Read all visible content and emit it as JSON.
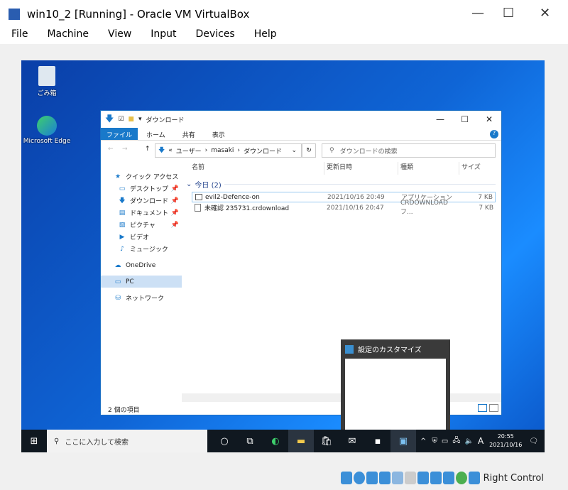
{
  "window": {
    "title": "win10_2 [Running] - Oracle VM VirtualBox",
    "minimize": "—",
    "maximize": "☐",
    "close": "✕"
  },
  "menu": [
    "File",
    "Machine",
    "View",
    "Input",
    "Devices",
    "Help"
  ],
  "desktop": {
    "icons": [
      {
        "label": "ごみ箱",
        "icon": "recycle-bin"
      },
      {
        "label": "Microsoft Edge",
        "icon": "edge"
      }
    ]
  },
  "explorer": {
    "title": "ダウンロード",
    "ribbon_tabs": [
      "ファイル",
      "ホーム",
      "共有",
      "表示"
    ],
    "address": {
      "prefix": "«",
      "parts": [
        "ユーザー",
        "masaki",
        "ダウンロード"
      ]
    },
    "search_placeholder": "ダウンロードの検索",
    "columns": [
      "名前",
      "更新日時",
      "種類",
      "サイズ"
    ],
    "group": "今日 (2)",
    "files": [
      {
        "name": "evil2-Defence-on",
        "date": "2021/10/16 20:49",
        "type": "アプリケーション",
        "size": "7 KB"
      },
      {
        "name": "未確認 235731.crdownload",
        "date": "2021/10/16 20:47",
        "type": "CRDOWNLOAD フ...",
        "size": "7 KB"
      }
    ],
    "nav": [
      {
        "label": "クイック アクセス",
        "icon": "star",
        "pinned": false,
        "level": 0
      },
      {
        "label": "デスクトップ",
        "icon": "desktop",
        "pinned": true,
        "level": 1
      },
      {
        "label": "ダウンロード",
        "icon": "download",
        "pinned": true,
        "level": 1
      },
      {
        "label": "ドキュメント",
        "icon": "document",
        "pinned": true,
        "level": 1
      },
      {
        "label": "ピクチャ",
        "icon": "picture",
        "pinned": true,
        "level": 1
      },
      {
        "label": "ビデオ",
        "icon": "video",
        "pinned": false,
        "level": 1
      },
      {
        "label": "ミュージック",
        "icon": "music",
        "pinned": false,
        "level": 1
      },
      {
        "label": "OneDrive",
        "icon": "cloud",
        "pinned": false,
        "level": 0
      },
      {
        "label": "PC",
        "icon": "pc",
        "pinned": false,
        "level": 0,
        "selected": true
      },
      {
        "label": "ネットワーク",
        "icon": "network",
        "pinned": false,
        "level": 0
      }
    ],
    "status": "2 個の項目"
  },
  "preview": {
    "title": "設定のカスタマイズ"
  },
  "taskbar": {
    "search_placeholder": "ここに入力して検索",
    "time": "20:55",
    "date": "2021/10/16",
    "ime": "A"
  },
  "statusbar": {
    "host_key": "Right Control"
  },
  "colors": {
    "accent": "#1979ca",
    "taskbar": "#101820"
  }
}
